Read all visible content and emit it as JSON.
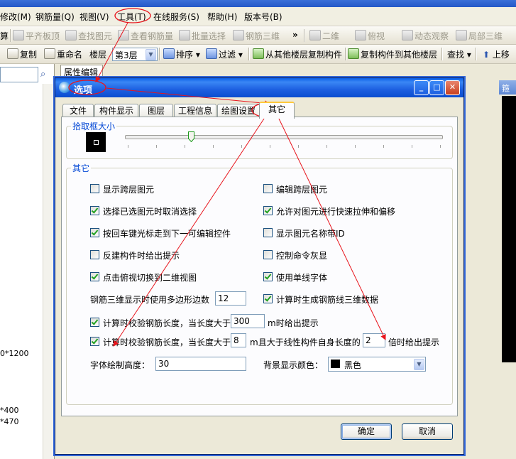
{
  "menubar": {
    "items": [
      {
        "label": "修改(M)"
      },
      {
        "label": "钢筋量(Q)"
      },
      {
        "label": "视图(V)"
      },
      {
        "label": "工具(T)"
      },
      {
        "label": "在线服务(S)"
      },
      {
        "label": "帮助(H)"
      },
      {
        "label": "版本号(B)"
      }
    ]
  },
  "toolbar1": {
    "items": [
      {
        "label": "算"
      },
      {
        "label": "平齐板顶"
      },
      {
        "label": "查找图元"
      },
      {
        "label": "查看钢筋量"
      },
      {
        "label": "批量选择"
      },
      {
        "label": "钢筋三维"
      },
      {
        "label": "»"
      },
      {
        "label": "二维"
      },
      {
        "label": "俯视"
      },
      {
        "label": "动态观察"
      },
      {
        "label": "局部三维"
      }
    ]
  },
  "toolbar2": {
    "copy": "复制",
    "rename": "重命名",
    "floor_label": "楼层",
    "floor_value": "第3层",
    "sort": "排序",
    "filter": "过滤",
    "copy_from_other": "从其他楼层复制构件",
    "copy_to_other": "复制构件到其他楼层",
    "find": "查找",
    "up": "上移"
  },
  "left_panel": {
    "texts": [
      "0*1200",
      "*400",
      "*470"
    ]
  },
  "props_tab": "属性编辑",
  "right_panel_label": "箍筋",
  "dialog": {
    "title": "选项",
    "tabs": [
      "文件",
      "构件显示",
      "图层",
      "工程信息",
      "绘图设置",
      "其它"
    ],
    "pick_group": "拾取框大小",
    "other_group": "其它",
    "left_checks": [
      {
        "label": "显示跨层图元",
        "checked": false
      },
      {
        "label": "选择已选图元时取消选择",
        "checked": true
      },
      {
        "label": "按回车键光标走到下一可编辑控件",
        "checked": true
      },
      {
        "label": "反建构件时给出提示",
        "checked": false
      },
      {
        "label": "点击俯视切换到二维视图",
        "checked": true
      }
    ],
    "right_checks": [
      {
        "label": "编辑跨层图元",
        "checked": false
      },
      {
        "label": "允许对图元进行快速拉伸和偏移",
        "checked": true
      },
      {
        "label": "显示图元名称带ID",
        "checked": false
      },
      {
        "label": "控制命令灰显",
        "checked": false
      },
      {
        "label": "使用单线字体",
        "checked": true
      },
      {
        "label": "计算时生成钢筋线三维数据",
        "checked": true
      }
    ],
    "polygon_label": "钢筋三维显示时使用多边形边数",
    "polygon_value": "12",
    "check_len1": {
      "checked": true,
      "prefix": "计算时校验钢筋长度，当长度大于",
      "value": "300",
      "suffix": "m时给出提示"
    },
    "check_len2": {
      "checked": true,
      "prefix": "计算时校验钢筋长度，当长度大于",
      "value": "8",
      "middle": "m且大于线性构件自身长度的",
      "value2": "2",
      "suffix": "倍时给出提示"
    },
    "font_height_label": "字体绘制高度",
    "font_height_value": "30",
    "bg_color_label": "背景显示颜色",
    "bg_color_value": "黑色",
    "ok": "确定",
    "cancel": "取消"
  },
  "colors": {
    "annotation_red": "#e8141c",
    "title_blue": "#0a5fe7"
  }
}
